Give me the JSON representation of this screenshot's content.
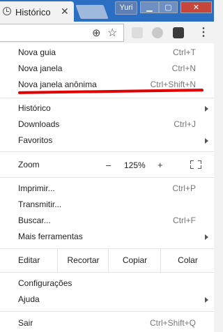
{
  "tab": {
    "title": "Histórico",
    "close": "✕"
  },
  "window": {
    "user": "Yuri",
    "minimize": "▁",
    "maximize": "▢",
    "close": "✕"
  },
  "toolbar": {
    "zoom_icon": "⊕",
    "star_icon": "☆",
    "menu_icon": "⋮"
  },
  "menu": {
    "items1": [
      {
        "label": "Nova guia",
        "shortcut": "Ctrl+T"
      },
      {
        "label": "Nova janela",
        "shortcut": "Ctrl+N"
      },
      {
        "label": "Nova janela anônima",
        "shortcut": "Ctrl+Shift+N"
      }
    ],
    "items2": [
      {
        "label": "Histórico",
        "shortcut": ""
      },
      {
        "label": "Downloads",
        "shortcut": "Ctrl+J"
      },
      {
        "label": "Favoritos",
        "shortcut": ""
      }
    ],
    "zoom": {
      "label": "Zoom",
      "minus": "–",
      "value": "125%",
      "plus": "+"
    },
    "items3": [
      {
        "label": "Imprimir...",
        "shortcut": "Ctrl+P"
      },
      {
        "label": "Transmitir...",
        "shortcut": ""
      },
      {
        "label": "Buscar...",
        "shortcut": "Ctrl+F"
      },
      {
        "label": "Mais ferramentas",
        "shortcut": ""
      }
    ],
    "edit": {
      "label": "Editar",
      "cut": "Recortar",
      "copy": "Copiar",
      "paste": "Colar"
    },
    "items4": [
      {
        "label": "Configurações",
        "shortcut": ""
      },
      {
        "label": "Ajuda",
        "shortcut": ""
      }
    ],
    "exit": {
      "label": "Sair",
      "shortcut": "Ctrl+Shift+Q"
    }
  },
  "colors": {
    "annotation": "#e00000",
    "titlebar": "#2c6fc2"
  }
}
